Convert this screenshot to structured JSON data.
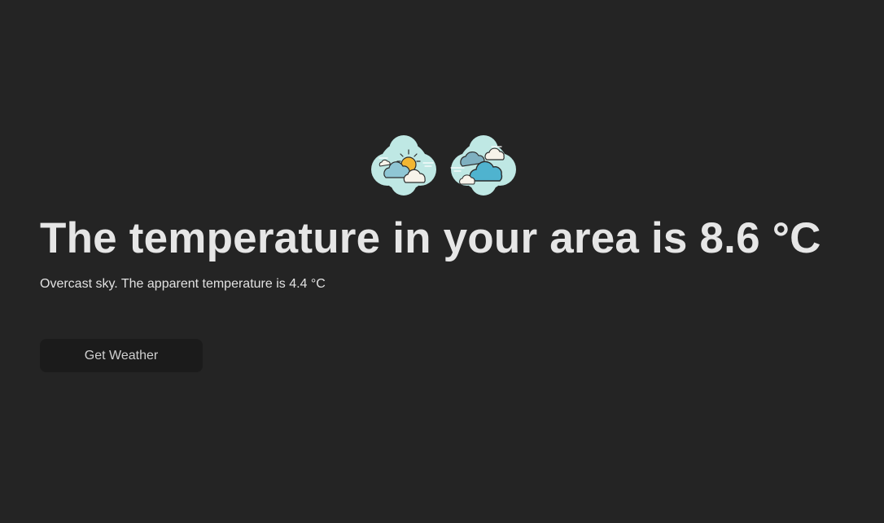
{
  "weather": {
    "icons": [
      "partly-cloudy-icon",
      "overcast-icon"
    ],
    "headline": "The temperature in your area is 8.6 °C",
    "description": "Overcast sky. The apparent temperature is 4.4 °C"
  },
  "actions": {
    "get_weather_label": "Get Weather"
  },
  "colors": {
    "background": "#242424",
    "text": "#e6e6e6",
    "button_bg": "#1b1b1b",
    "icon_badge": "#bfe8e4",
    "cloud_blue": "#4fb3cf",
    "sun": "#f2b632"
  }
}
